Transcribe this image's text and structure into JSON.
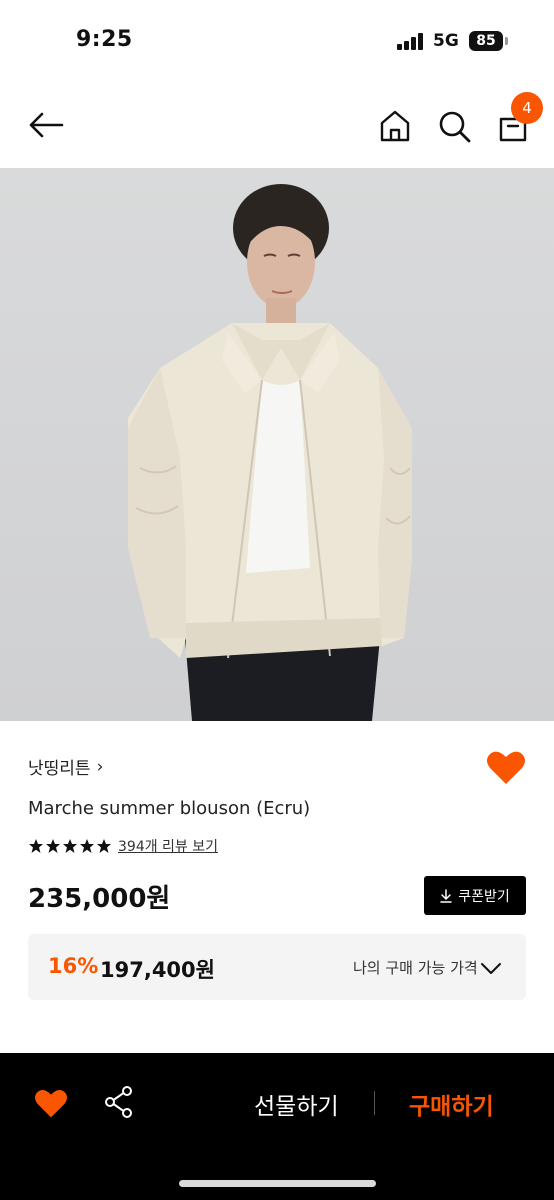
{
  "status_bar": {
    "time": "9:25",
    "network": "5G",
    "battery": "85"
  },
  "nav": {
    "back_icon": "arrow-left-icon",
    "home_icon": "home-icon",
    "search_icon": "search-icon",
    "bag_icon": "shopping-bag-icon",
    "cart_count": "4"
  },
  "product": {
    "brand": "낫띵리튼",
    "brand_chevron": "›",
    "name": "Marche summer blouson (Ecru)",
    "rating_stars": 5,
    "review_link": "394개 리뷰 보기",
    "price": "235,000원",
    "coupon_label": "쿠폰받기",
    "favorited": true
  },
  "my_price": {
    "discount_rate": "16%",
    "price": "197,400원",
    "label": "나의 구매 가능 가격"
  },
  "action_bar": {
    "gift_label": "선물하기",
    "buy_label": "구매하기"
  },
  "colors": {
    "accent": "#fa5500",
    "bar_background": "#000000",
    "price_box_background": "#f4f4f4"
  }
}
